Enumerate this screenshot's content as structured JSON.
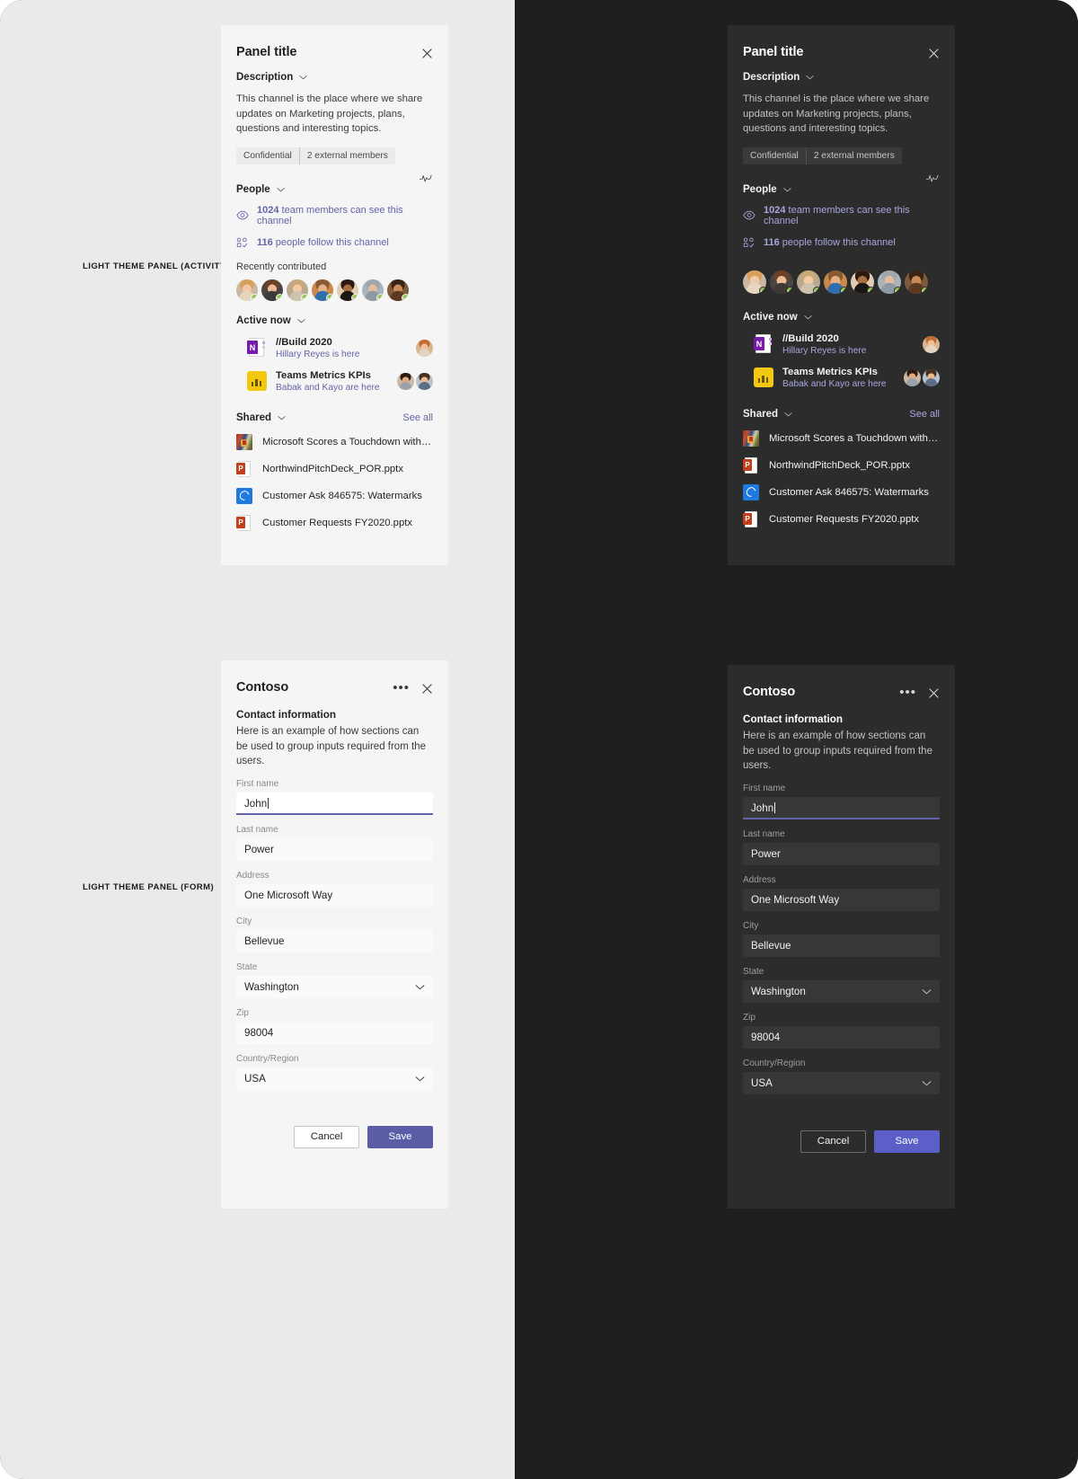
{
  "annotations": {
    "activity": "LIGHT THEME PANEL (ACTIVITY)",
    "form": "LIGHT THEME PANEL (FORM)"
  },
  "colors": {
    "accent": "#6264a7",
    "accent_dark_text": "#a6a7dc",
    "save_button": "#5b5ea6",
    "presence_available": "#92c353",
    "light_panel_bg": "#f5f5f5",
    "dark_panel_bg": "#2d2c2c",
    "light_page_bg": "#eaeaea",
    "dark_page_bg": "#1f1f1f"
  },
  "activity_panel": {
    "title": "Panel title",
    "close_icon": "close-icon",
    "activity_icon": "pulse-activity-icon",
    "description_section": {
      "label": "Description",
      "chevron": "chevron-down-icon",
      "body": "This channel is the place where we share updates on Marketing projects, plans, questions and interesting topics.",
      "tags": [
        "Confidential",
        "2 external members"
      ]
    },
    "people_section": {
      "label": "People",
      "chevron": "chevron-down-icon",
      "stats": [
        {
          "icon": "eye-icon",
          "count": "1024",
          "text": " team members can see this channel"
        },
        {
          "icon": "follow-people-icon",
          "count": "116",
          "text": " people follow this channel"
        }
      ],
      "recently_contributed_label": "Recently contributed",
      "avatars": [
        {
          "name": "avatar-1",
          "hair": "#d9a05b",
          "skin": "#f0c9a8",
          "shirt": "#e8d5c0",
          "bg": "#cbb8a4"
        },
        {
          "name": "avatar-2",
          "hair": "#6b4226",
          "skin": "#edbb95",
          "shirt": "#3d3a38",
          "bg": "#4a4442"
        },
        {
          "name": "avatar-3",
          "hair": "#c8a878",
          "skin": "#f2cba5",
          "shirt": "#cfc3b0",
          "bg": "#b9a98f"
        },
        {
          "name": "avatar-4",
          "hair": "#8a5a32",
          "skin": "#e8b088",
          "shirt": "#2f6fae",
          "bg": "#c98a4b"
        },
        {
          "name": "avatar-5",
          "hair": "#2b1a10",
          "skin": "#a9703f",
          "shirt": "#1b1714",
          "bg": "#e0cdb2"
        },
        {
          "name": "avatar-6",
          "hair": "#9ea7ab",
          "skin": "#e6bd9c",
          "shirt": "#8d9aa3",
          "bg": "#aab4bb"
        },
        {
          "name": "avatar-7",
          "hair": "#3a2415",
          "skin": "#c98c58",
          "shirt": "#5c3a22",
          "bg": "#7e5b3a"
        }
      ]
    },
    "active_now_section": {
      "label": "Active now",
      "chevron": "chevron-down-icon",
      "items": [
        {
          "icon": "onenote-icon",
          "title": "//Build 2020",
          "subtitle": "Hillary Reyes is here",
          "avatars": [
            {
              "name": "avatar-hillary",
              "hair": "#c06c32",
              "skin": "#f0c09a",
              "shirt": "#e2d4c3",
              "bg": "#d9b68f"
            }
          ]
        },
        {
          "icon": "powerbi-icon",
          "title": "Teams Metrics KPIs",
          "subtitle": "Babak and Kayo are here",
          "avatars": [
            {
              "name": "avatar-babak",
              "hair": "#2d1b10",
              "skin": "#e0a980",
              "shirt": "#9aa3ab",
              "bg": "#cbb9a6"
            },
            {
              "name": "avatar-kayo",
              "hair": "#4a2f1c",
              "skin": "#e8b98f",
              "shirt": "#5d6f84",
              "bg": "#b7c3cf"
            }
          ]
        }
      ]
    },
    "shared_section": {
      "label": "Shared",
      "chevron": "chevron-down-icon",
      "see_all": "See all",
      "files": [
        {
          "icon": "news-thumbnail-icon",
          "name": "Microsoft Scores a Touchdown with NF..."
        },
        {
          "icon": "powerpoint-icon",
          "name": "NorthwindPitchDeck_POR.pptx"
        },
        {
          "icon": "planner-icon",
          "name": "Customer Ask 846575: Watermarks"
        },
        {
          "icon": "powerpoint-icon",
          "name": "Customer Requests FY2020.pptx"
        }
      ]
    }
  },
  "form_panel": {
    "title": "Contoso",
    "more_icon": "more-options-icon",
    "close_icon": "close-icon",
    "section_title": "Contact information",
    "section_description": "Here is an example of how sections can be used to group inputs required from the users.",
    "fields": [
      {
        "label": "First name",
        "value": "John",
        "type": "text",
        "focused": true
      },
      {
        "label": "Last name",
        "value": "Power",
        "type": "text",
        "focused": false
      },
      {
        "label": "Address",
        "value": "One Microsoft Way",
        "type": "text",
        "focused": false
      },
      {
        "label": "City",
        "value": "Bellevue",
        "type": "text",
        "focused": false
      },
      {
        "label": "State",
        "value": "Washington",
        "type": "select",
        "focused": false
      },
      {
        "label": "Zip",
        "value": "98004",
        "type": "text",
        "focused": false
      },
      {
        "label": "Country/Region",
        "value": "USA",
        "type": "select",
        "focused": false
      }
    ],
    "cancel_label": "Cancel",
    "save_label": "Save"
  }
}
